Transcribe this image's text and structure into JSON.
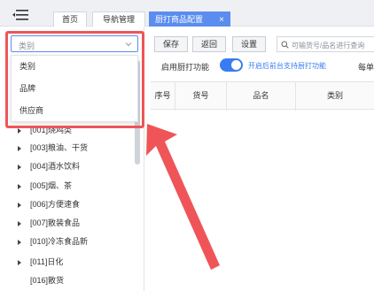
{
  "tabs": {
    "home": "首页",
    "nav": "导航管理",
    "active": "厨打商品配置",
    "close": "×"
  },
  "category_select": {
    "value": "类别"
  },
  "dropdown_options": [
    "类别",
    "品牌",
    "供应商"
  ],
  "tree": [
    {
      "label": "[001]烧鸡类",
      "expandable": true
    },
    {
      "label": "[003]粮油、干货",
      "expandable": true
    },
    {
      "label": "[004]酒水饮料",
      "expandable": true
    },
    {
      "label": "[005]烟、茶",
      "expandable": true
    },
    {
      "label": "[006]方便速食",
      "expandable": true
    },
    {
      "label": "[007]散装食品",
      "expandable": true
    },
    {
      "label": "[010]冷冻食品新",
      "expandable": true
    },
    {
      "label": "[011]日化",
      "expandable": true
    },
    {
      "label": "[016]散货",
      "expandable": false
    }
  ],
  "toolbar": {
    "save": "保存",
    "back": "返回",
    "settings": "设置",
    "search_placeholder": "可输货号/品名进行查询"
  },
  "options": {
    "enable_label": "启用厨打功能",
    "enable_desc": "开启后前台支持厨打功能",
    "more": "每单",
    "enabled": true
  },
  "table": {
    "columns": [
      "序号",
      "货号",
      "品名",
      "类别"
    ]
  },
  "colors": {
    "accent": "#5b8def",
    "toggle": "#3a7cf0",
    "annotation": "#ef5558"
  },
  "icons": {
    "menu": "menu-toggle-icon",
    "search": "search-icon",
    "chevron": "chevron-down-icon"
  }
}
